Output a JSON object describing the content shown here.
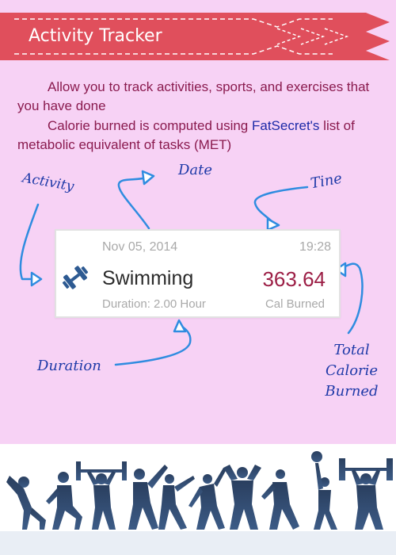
{
  "banner": {
    "title": "Activity Tracker",
    "color": "#e04f5c"
  },
  "intro": {
    "line1": "Allow you to track activities, sports, and exercises that you have done",
    "line2_prefix": "Calorie burned is computed using ",
    "line2_link": "FatSecret's",
    "line2_suffix": " list of metabolic equivalent of tasks (MET)"
  },
  "annotations": {
    "activity": "Activity",
    "date": "Date",
    "time": "Tine",
    "duration": "Duration",
    "total": "Total Calorie Burned"
  },
  "card": {
    "date": "Nov 05, 2014",
    "time": "19:28",
    "icon": "dumbbell-icon",
    "activity": "Swimming",
    "calories": "363.64",
    "duration": "Duration: 2.00 Hour",
    "unit": "Cal Burned",
    "calories_color": "#9c1f46"
  },
  "footer": {
    "image": "athlete-silhouettes"
  },
  "colors": {
    "background": "#f7d2f5",
    "text": "#8a1a4e",
    "handwriting": "#1f3aa8",
    "arrow": "#2f8ce0"
  }
}
